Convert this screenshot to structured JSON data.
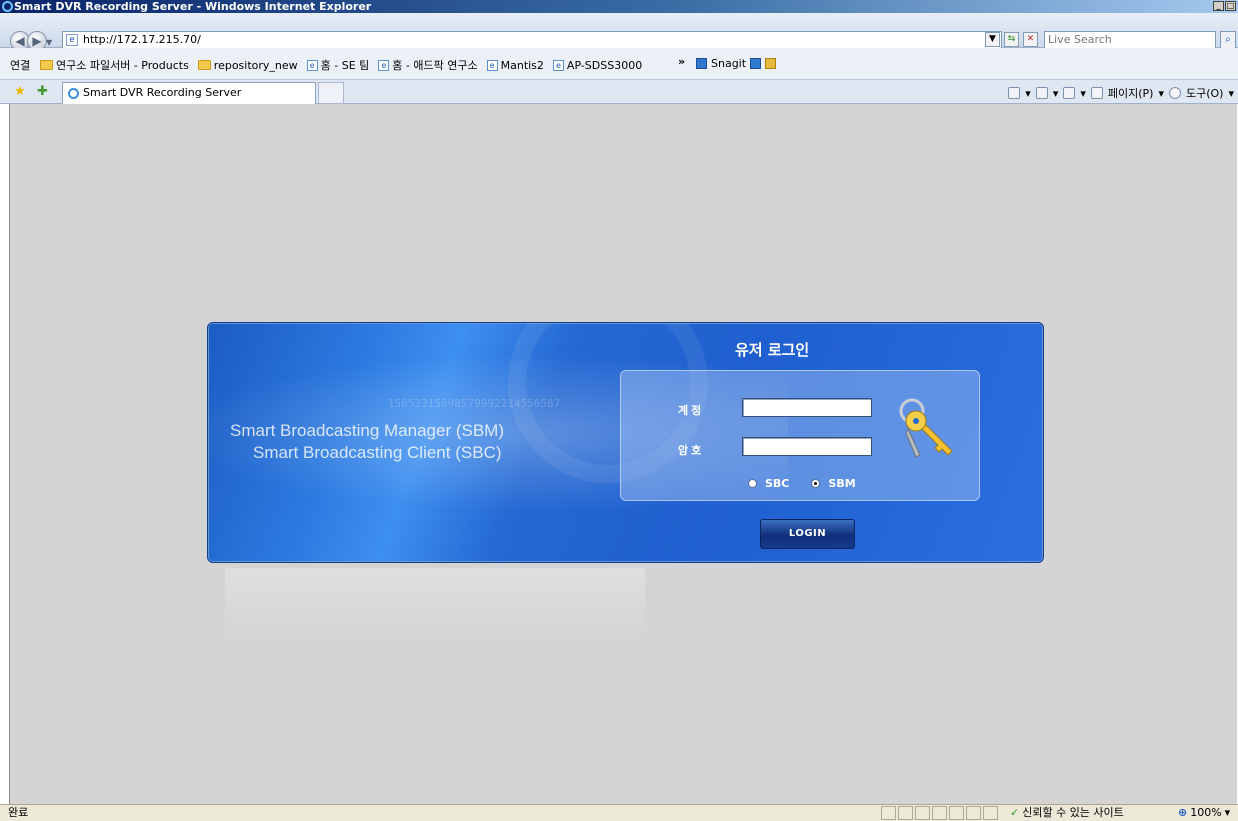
{
  "window": {
    "title": "Smart DVR Recording Server - Windows Internet Explorer",
    "controls": [
      "_",
      "□"
    ]
  },
  "addressbar": {
    "url": "http://172.17.215.70/",
    "search_placeholder": "Live Search"
  },
  "links": {
    "label": "연결",
    "items": [
      {
        "icon": "folder-icon",
        "label": "연구소 파일서버 - Products"
      },
      {
        "icon": "folder-icon",
        "label": "repository_new"
      },
      {
        "icon": "ie-page-icon",
        "label": "홈 - SE 팀"
      },
      {
        "icon": "ie-page-icon",
        "label": "홈 - 애드팍 연구소"
      },
      {
        "icon": "ie-page-icon",
        "label": "Mantis2"
      },
      {
        "icon": "ie-page-icon",
        "label": "AP-SDSS3000"
      }
    ],
    "overflow": "»",
    "snagit": "Snagit"
  },
  "tab": {
    "title": "Smart DVR Recording Server"
  },
  "commands": {
    "page": "페이지(P)",
    "tools": "도구(O)"
  },
  "login": {
    "brand_line1": "Smart Broadcasting Manager (SBM)",
    "brand_line2": "Smart Broadcasting Client (SBC)",
    "numbers_deco": "15652315698579992214556587",
    "title": "유저 로그인",
    "account_label": "계정",
    "password_label": "암호",
    "account_value": "",
    "password_value": "",
    "options": [
      {
        "label": "SBC",
        "selected": false
      },
      {
        "label": "SBM",
        "selected": true
      }
    ],
    "button": "LOGIN"
  },
  "status": {
    "text": "완료",
    "zone": "신뢰할 수 있는 사이트",
    "zoom": "100%"
  },
  "colors": {
    "panel_blue": "#2569d3",
    "button_navy": "#0f2f7a",
    "content_bg": "#d4d4d4"
  }
}
